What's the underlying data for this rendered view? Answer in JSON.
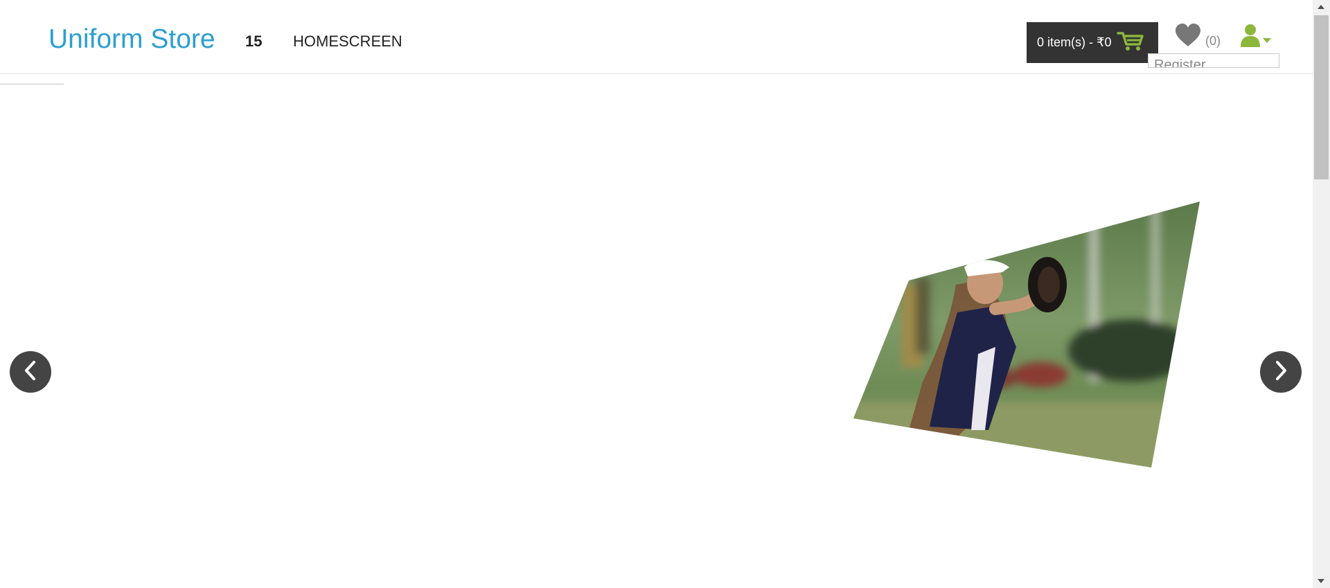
{
  "header": {
    "logo": "Uniform Store",
    "nav": [
      "15",
      "HOMESCREEN"
    ],
    "cart_label": "0 item(s) - ₹0",
    "wishlist_count": "(0)",
    "register_label": "Register"
  },
  "colors": {
    "logo": "#2c9fd0",
    "cart_bg": "#333333",
    "accent_green": "#8cb63c",
    "arrow_bg": "#444444"
  },
  "slider": {
    "image_alt": "softball player with glove",
    "prev_icon": "chevron-left-icon",
    "next_icon": "chevron-right-icon"
  },
  "icons": {
    "cart": "shopping-cart-icon",
    "wishlist": "heart-icon",
    "user": "user-icon"
  }
}
